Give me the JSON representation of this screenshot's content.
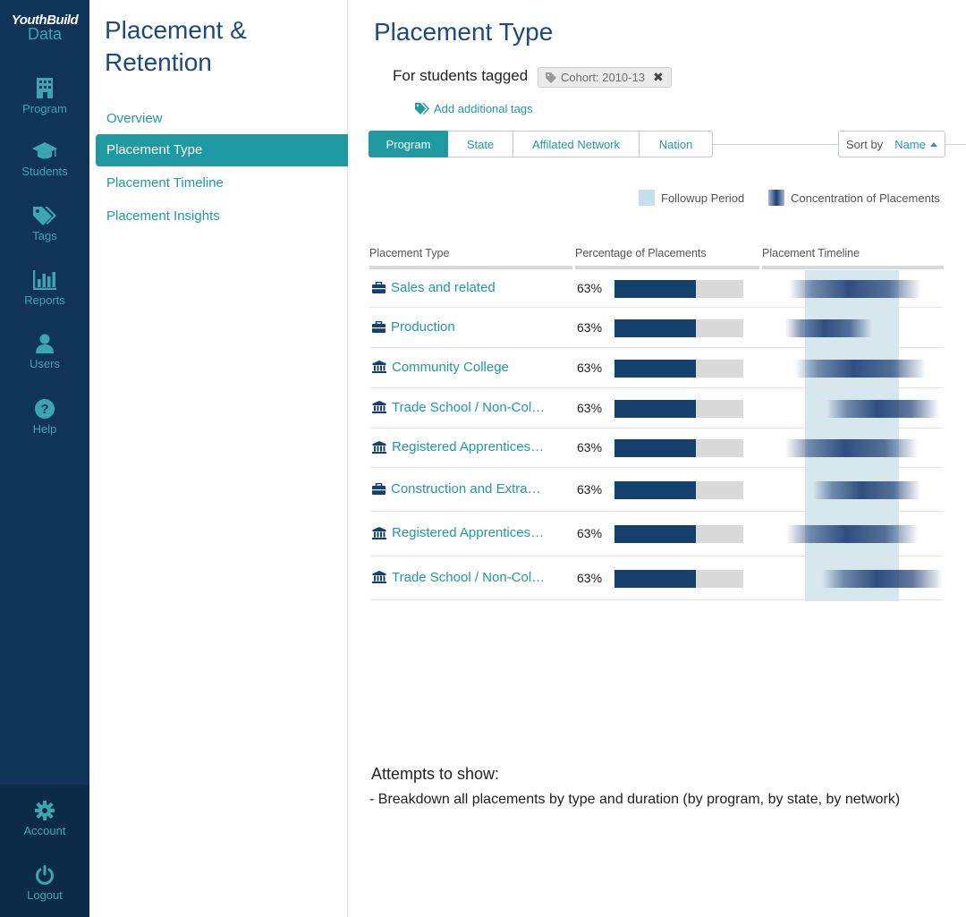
{
  "brand": {
    "name": "YouthBuild",
    "sub": "Data"
  },
  "rail": {
    "items": [
      {
        "label": "Program",
        "icon": "building-icon"
      },
      {
        "label": "Students",
        "icon": "graduation-cap-icon"
      },
      {
        "label": "Tags",
        "icon": "tags-icon"
      },
      {
        "label": "Reports",
        "icon": "bar-chart-icon"
      },
      {
        "label": "Users",
        "icon": "user-icon"
      },
      {
        "label": "Help",
        "icon": "question-icon"
      }
    ],
    "bottom": [
      {
        "label": "Account",
        "icon": "gear-icon"
      },
      {
        "label": "Logout",
        "icon": "power-icon"
      }
    ]
  },
  "subnav": {
    "title_line1": "Placement &",
    "title_line2": "Retention",
    "items": [
      {
        "label": "Overview"
      },
      {
        "label": "Placement Type"
      },
      {
        "label": "Placement Timeline"
      },
      {
        "label": "Placement Insights"
      }
    ],
    "active_index": 1
  },
  "main": {
    "title": "Placement Type",
    "tagged_label": "For students tagged",
    "tag_chip": "Cohort: 2010-13",
    "add_tags": "Add additional tags",
    "tabs": [
      "Program",
      "State",
      "Affilated Network",
      "Nation"
    ],
    "active_tab": 0,
    "sort_label": "Sort by",
    "sort_value": "Name",
    "legend": {
      "followup": "Followup Period",
      "concentration": "Concentration of Placements"
    },
    "columns": {
      "type": "Placement Type",
      "pct": "Percentage of Placements",
      "timeline": "Placement Timeline"
    },
    "rows": [
      {
        "name": "Sales and related",
        "icon": "briefcase-icon",
        "pct_label": "63%",
        "pct": 0.63
      },
      {
        "name": "Production",
        "icon": "briefcase-icon",
        "pct_label": "63%",
        "pct": 0.63
      },
      {
        "name": "Community College",
        "icon": "institution-icon",
        "pct_label": "63%",
        "pct": 0.63
      },
      {
        "name": "Trade School / Non-Col…",
        "icon": "institution-icon",
        "pct_label": "63%",
        "pct": 0.63
      },
      {
        "name": "Registered Apprentices…",
        "icon": "institution-icon",
        "pct_label": "63%",
        "pct": 0.63
      },
      {
        "name": "Construction and Extra…",
        "icon": "briefcase-icon",
        "pct_label": "63%",
        "pct": 0.63
      },
      {
        "name": "Registered Apprentices…",
        "icon": "institution-icon",
        "pct_label": "63%",
        "pct": 0.63
      },
      {
        "name": "Trade School / Non-Col…",
        "icon": "institution-icon",
        "pct_label": "63%",
        "pct": 0.63
      }
    ],
    "notes_title": "Attempts to show:",
    "notes_text": "- Breakdown all placements by type and duration (by program, by state, by network)"
  },
  "colors": {
    "rail": "#0f3457",
    "accent": "#1f9aa3",
    "title": "#1d4a7a",
    "bar": "#14406e",
    "followup": "#d6e7ee"
  }
}
